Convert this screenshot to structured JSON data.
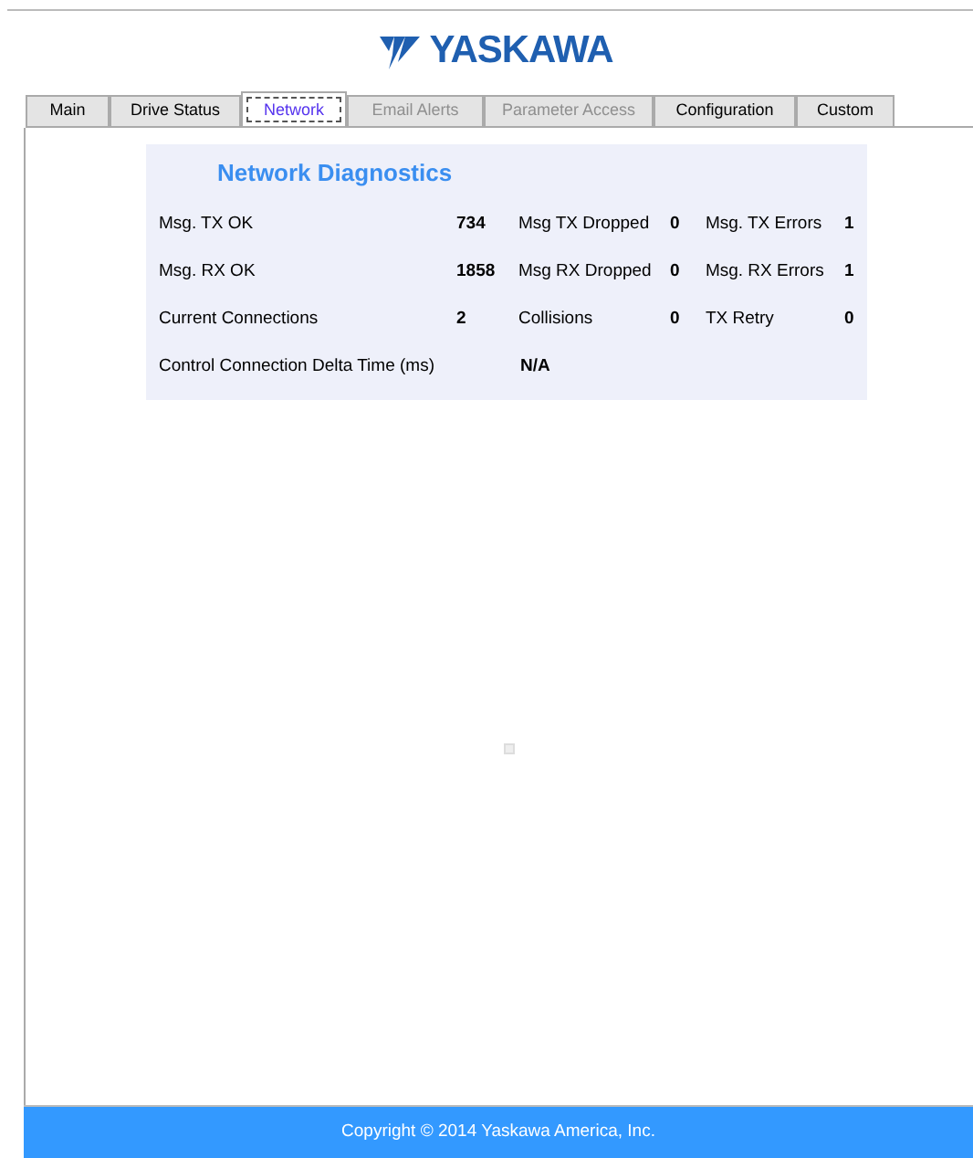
{
  "logo": {
    "text": "YASKAWA"
  },
  "tabs": [
    {
      "label": "Main",
      "selected": false,
      "disabled": false
    },
    {
      "label": "Drive Status",
      "selected": false,
      "disabled": false
    },
    {
      "label": "Network",
      "selected": true,
      "disabled": false
    },
    {
      "label": "Email Alerts",
      "selected": false,
      "disabled": true
    },
    {
      "label": "Parameter Access",
      "selected": false,
      "disabled": true
    },
    {
      "label": "Configuration",
      "selected": false,
      "disabled": false
    },
    {
      "label": "Custom",
      "selected": false,
      "disabled": false
    }
  ],
  "diagnostics": {
    "title": "Network Diagnostics",
    "rows": [
      [
        {
          "label": "Msg. TX OK",
          "value": "734"
        },
        {
          "label": "Msg TX Dropped",
          "value": "0"
        },
        {
          "label": "Msg. TX Errors",
          "value": "1"
        }
      ],
      [
        {
          "label": "Msg. RX OK",
          "value": "1858"
        },
        {
          "label": "Msg RX Dropped",
          "value": "0"
        },
        {
          "label": "Msg. RX Errors",
          "value": "1"
        }
      ],
      [
        {
          "label": "Current Connections",
          "value": "2"
        },
        {
          "label": "Collisions",
          "value": "0"
        },
        {
          "label": "TX Retry",
          "value": "0"
        }
      ],
      [
        {
          "label": "Control Connection Delta Time (ms)",
          "value": "N/A"
        }
      ]
    ]
  },
  "footer": {
    "text": "Copyright © 2014 Yaskawa America, Inc."
  }
}
